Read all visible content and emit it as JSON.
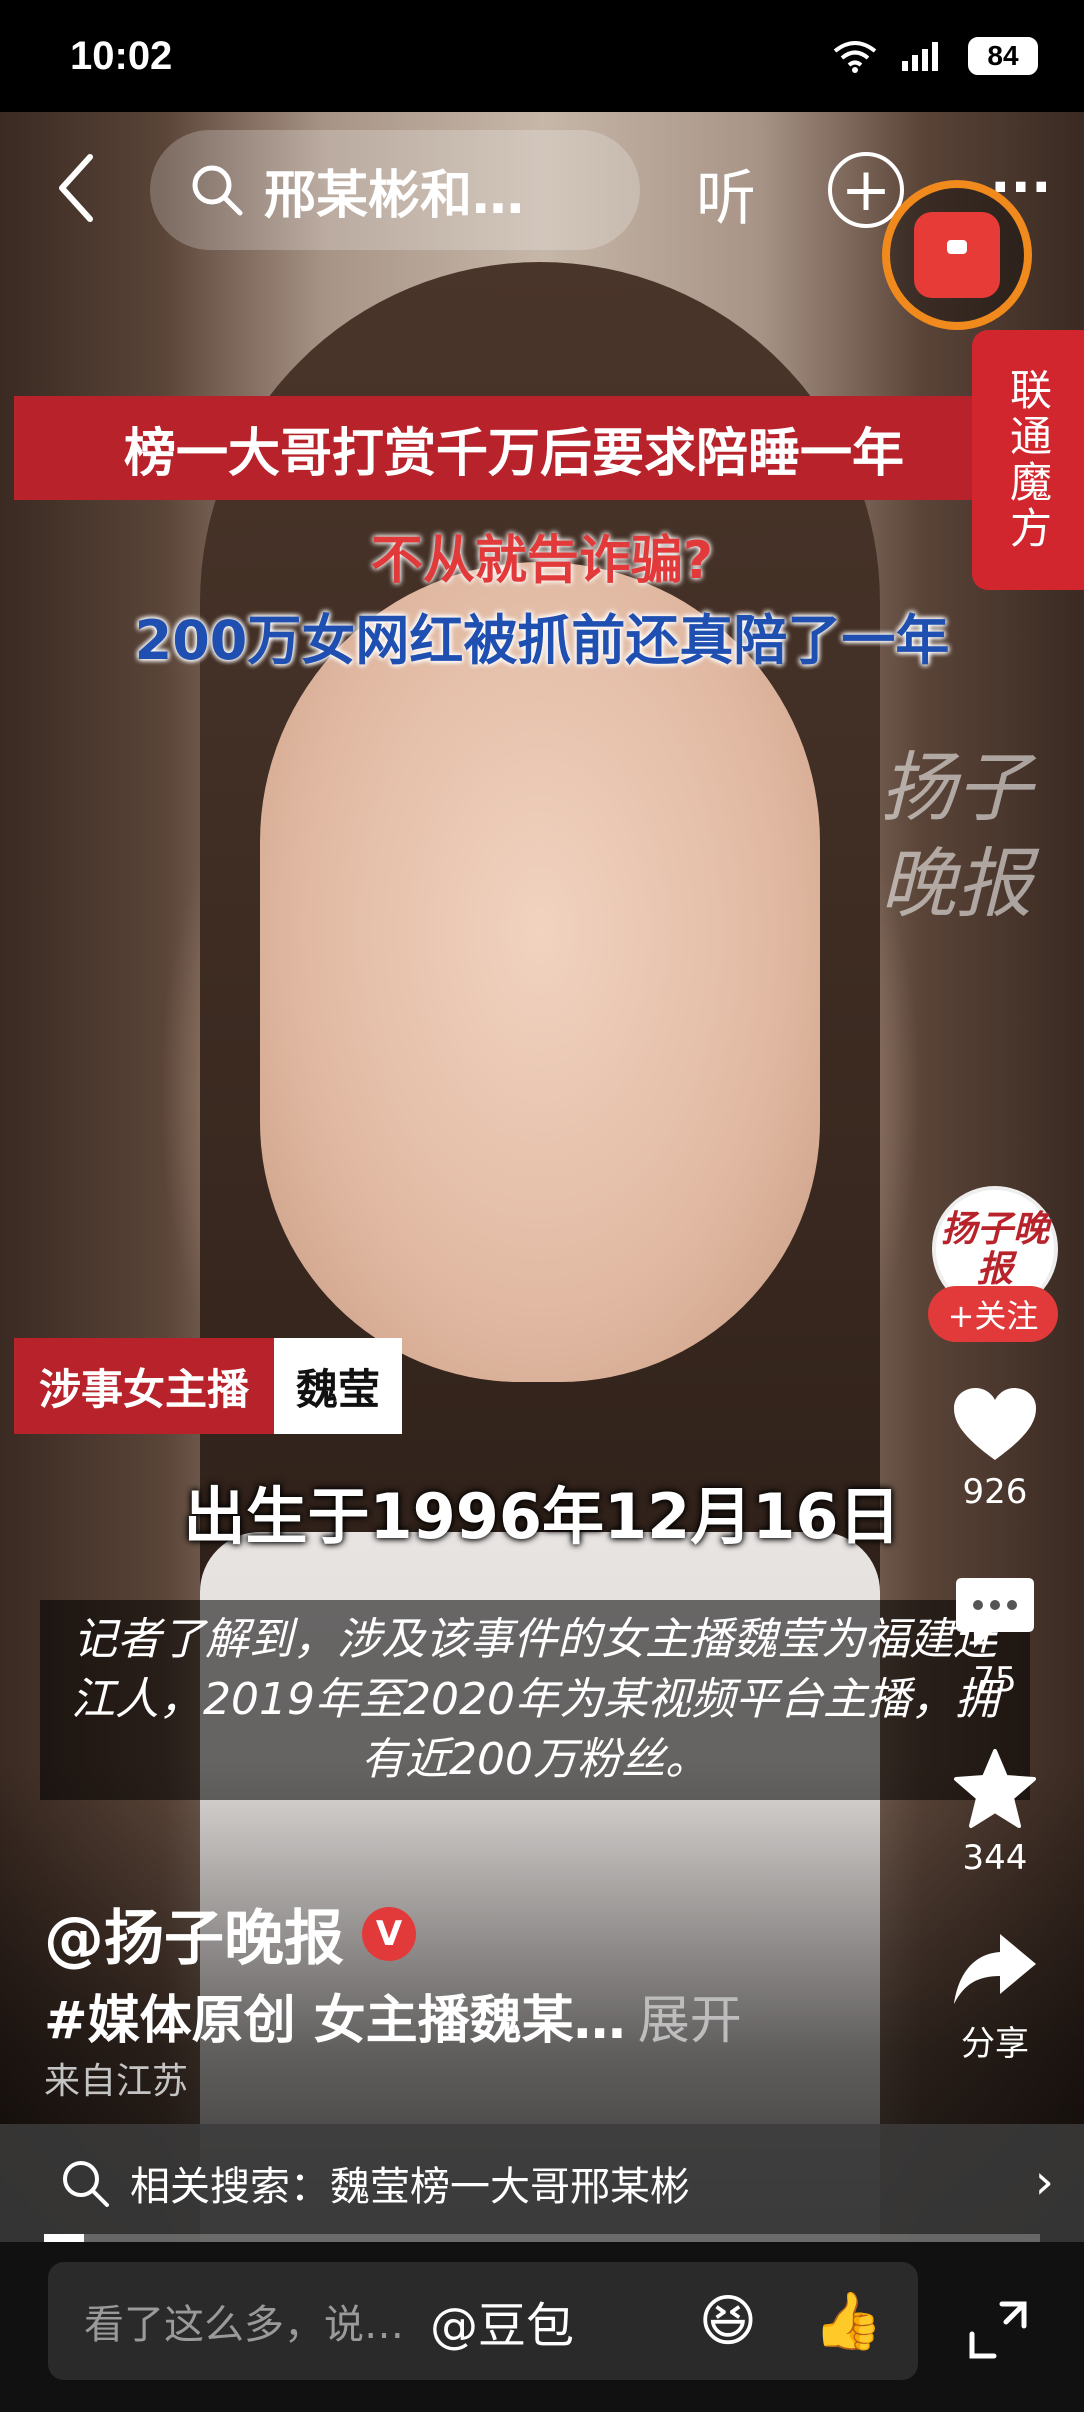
{
  "status_bar": {
    "time": "10:02",
    "battery": "84"
  },
  "nav": {
    "search_text": "邢某彬和…",
    "listen_label": "听"
  },
  "ad_tab": {
    "label": "联通魔方"
  },
  "video": {
    "headline": "榜一大哥打赏千万后要求陪睡一年",
    "caption_red": "不从就告诈骗?",
    "caption_blue": "200万女网红被抓前还真陪了一年",
    "watermark": "扬子晚报",
    "name_tag_label": "涉事女主播",
    "name_tag_value": "魏莹",
    "birth": "出生于1996年12月16日",
    "subtitle": "记者了解到，涉及该事件的女主播魏莹为福建连江人，2019年至2020年为某视频平台主播，拥有近200万粉丝。"
  },
  "actions": {
    "avatar_text": "扬子晚报",
    "follow_label": "+关注",
    "likes": "926",
    "comments": "75",
    "favorites": "344",
    "share_label": "分享"
  },
  "info": {
    "author": "@扬子晚报",
    "verified": "V",
    "description": "#媒体原创 女主播魏某…",
    "expand": "展开",
    "location": "来自江苏"
  },
  "related_search": {
    "text": "相关搜索：魏莹榜一大哥邢某彬"
  },
  "progress": 0.04,
  "comment_bar": {
    "placeholder": "看了这么多，说…",
    "mention": "@豆包",
    "emoji1": "😆",
    "emoji2": "👍"
  },
  "icons": {
    "wifi": "wifi-icon",
    "signal": "signal-icon",
    "back": "chevron-left-icon",
    "search": "search-icon",
    "plus": "plus-circle-icon",
    "more": "more-icon",
    "red_packet": "red-packet-icon",
    "like": "heart-icon",
    "comment": "comment-icon",
    "favorite": "star-icon",
    "share": "share-icon",
    "fullscreen": "fullscreen-icon"
  },
  "colors": {
    "accent_red": "#e23a3a",
    "banner_red": "#b8222b",
    "caption_blue": "#1f4fb0",
    "ring_orange": "#f08a1d"
  }
}
